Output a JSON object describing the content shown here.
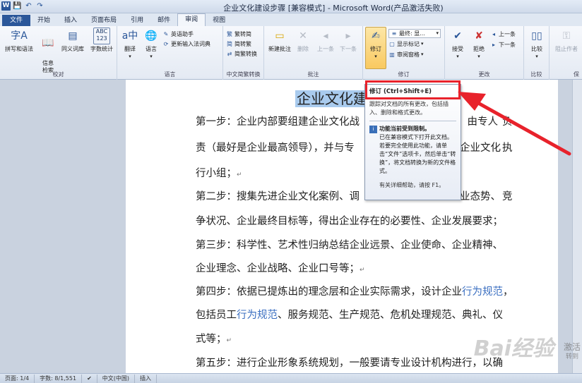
{
  "window": {
    "title": "企业文化建设步骤 [兼容模式] - Microsoft Word(产品激活失败)"
  },
  "qat": {
    "app_icon": "W",
    "save": "💾",
    "undo": "↶",
    "redo": "↷"
  },
  "tabs": [
    "文件",
    "开始",
    "插入",
    "页面布局",
    "引用",
    "邮件",
    "审阅",
    "视图"
  ],
  "ribbon": {
    "proofing": {
      "label": "校对",
      "spelling": "拼写和语法",
      "research": "信息\n检索",
      "thesaurus": "同义词库",
      "wordcount": "字数统计"
    },
    "language": {
      "label": "语言",
      "translate": "翻译",
      "language": "语言",
      "english_assistant": "英语助手",
      "update_ime": "更新输入法词典"
    },
    "chinese_conv": {
      "label": "中文简繁转换",
      "to_traditional": "繁转简",
      "to_simplified": "简转繁",
      "conversion": "简繁转换"
    },
    "comments": {
      "label": "批注",
      "new": "新建批注",
      "delete": "删除",
      "previous": "上一条",
      "next": "下一条"
    },
    "tracking": {
      "label": "修订",
      "track_changes": "修订",
      "final_display": "最终: 显...",
      "show_markup": "显示标记",
      "review_pane": "审阅窗格"
    },
    "changes": {
      "label": "更改",
      "accept": "接受",
      "reject": "拒绝",
      "previous": "上一条",
      "next": "下一条"
    },
    "compare": {
      "label": "比较",
      "compare": "比较"
    },
    "protect": {
      "label": "保",
      "block_authors": "阻止作者"
    }
  },
  "document": {
    "title": "企业文化建",
    "paragraphs": [
      "第一步：企业内部要组建企业文化战",
      "负",
      "责（最好是企业最高领导），并与专",
      "执",
      "行小组；",
      "第二步：搜集先进企业文化案例、调",
      "竞",
      "争状况、企业最终目标等，得出企业存在的必要性、企业发展要求；",
      "第三步：科学性、艺术性归纳总结企业远景、企业使命、企业精神、",
      "企业理念、企业战略、企业口号等；",
      "第五步：进行企业形象系统规划，一般要请专业设计机构进行，以确"
    ],
    "para1_tail": "，由专人",
    "para2_tail": "企业文化",
    "para6_tail": "业态势、",
    "para4_a": "第四步：依据已提炼出的理念层和企业实际需求，设计企业",
    "para4_link": "行为规范",
    "para5_a": "包括员工",
    "para5_link": "行为规范",
    "para5_b": "、服务规范、生产规范、危机处理规范、典礼、仪",
    "para6": "式等；"
  },
  "tooltip": {
    "title": "修订 (Ctrl+Shift+E)",
    "description": "跟踪对文档的所有更改，包括插入、删除和格式更改。",
    "warning_title": "功能当前受到限制。",
    "warning_text": "已在兼容模式下打开此文档。若要完全使用此功能，请单击“文件”选项卡，然后单击“转换”，将文档转换为新的文件格式。",
    "help": "有关详细帮助，请按 F1。"
  },
  "watermark": {
    "brand": "Bai经验",
    "side_line1": "激活",
    "side_line2": "转到"
  },
  "status": {
    "page": "页面: 1/4",
    "words": "字数: 8/1,551",
    "language": "中文(中国)",
    "mode": "插入"
  },
  "colors": {
    "file_tab": "#2b579a",
    "highlight": "#a9cbee",
    "annotation_red": "#e8222b",
    "link": "#3b6fc1"
  }
}
